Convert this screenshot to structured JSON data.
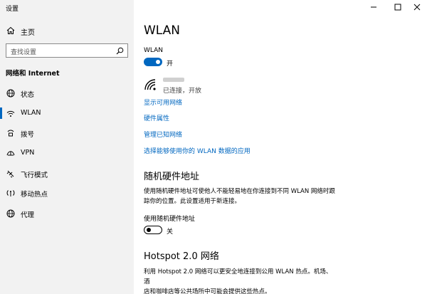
{
  "window": {
    "title": "设置"
  },
  "sidebar": {
    "home_label": "主页",
    "search_placeholder": "查找设置",
    "category": "网络和 Internet",
    "items": [
      {
        "label": "状态",
        "icon": "globe-icon"
      },
      {
        "label": "WLAN",
        "icon": "wifi-icon",
        "selected": true
      },
      {
        "label": "拨号",
        "icon": "dialup-icon"
      },
      {
        "label": "VPN",
        "icon": "vpn-icon"
      },
      {
        "label": "飞行模式",
        "icon": "airplane-icon"
      },
      {
        "label": "移动热点",
        "icon": "hotspot-icon"
      },
      {
        "label": "代理",
        "icon": "globe-icon"
      }
    ]
  },
  "main": {
    "title": "WLAN",
    "wlan_label": "WLAN",
    "wlan_state": "开",
    "network_status": "已连接，开放",
    "links": [
      "显示可用网络",
      "硬件属性",
      "管理已知网络",
      "选择能够使用你的 WLAN 数据的应用"
    ],
    "random_hw": {
      "heading": "随机硬件地址",
      "desc_line1": "使用随机硬件地址可使他人不能轻易地在你连接到不同 WLAN 网络时跟",
      "desc_line2": "踪你的位置。此设置适用于新连接。",
      "toggle_label": "使用随机硬件地址",
      "toggle_state": "关"
    },
    "hotspot": {
      "heading": "Hotspot 2.0 网络",
      "desc_line1": "利用 Hotspot 2.0 网络可以更安全地连接到公用 WLAN 热点。机场、酒",
      "desc_line2": "店和咖啡店等公共场所中可能会提供这些热点。"
    }
  },
  "colors": {
    "accent": "#0067c0",
    "sidebar_bg": "#f2f2f2"
  }
}
